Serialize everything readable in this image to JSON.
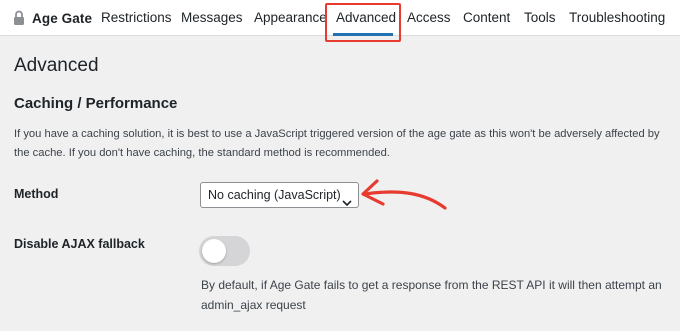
{
  "nav": {
    "brand": "Age Gate",
    "tabs": [
      {
        "label": "Restrictions"
      },
      {
        "label": "Messages"
      },
      {
        "label": "Appearance"
      },
      {
        "label": "Advanced",
        "active": true
      },
      {
        "label": "Access"
      },
      {
        "label": "Content"
      },
      {
        "label": "Tools"
      },
      {
        "label": "Troubleshooting"
      }
    ]
  },
  "page": {
    "title": "Advanced"
  },
  "section": {
    "title": "Caching / Performance",
    "description": "If you have a caching solution, it is best to use a JavaScript triggered version of the age gate as this won't be adversely affected by the cache. If you don't have caching, the standard method is recommended."
  },
  "fields": {
    "method": {
      "label": "Method",
      "value": "No caching (JavaScript)"
    },
    "ajax_fallback": {
      "label": "Disable AJAX fallback",
      "enabled": false,
      "description": "By default, if Age Gate fails to get a response from the REST API it will then attempt an admin_ajax request"
    }
  },
  "colors": {
    "accent": "#2271b1",
    "annotation": "#e63b2e",
    "toggle_off": "#d5d5d8",
    "background": "#f0f0f1"
  },
  "icons": {
    "brand": "lock-icon",
    "select": "chevron-down-icon",
    "annotation": "curved-arrow-icon"
  }
}
